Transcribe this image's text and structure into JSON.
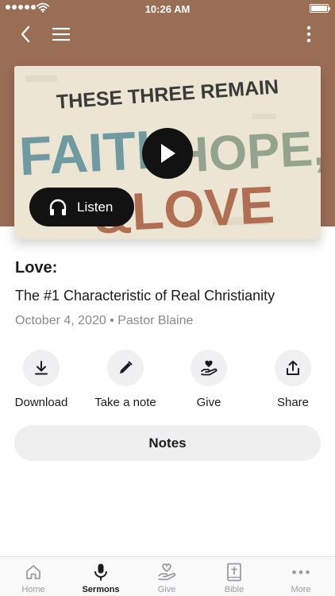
{
  "status_bar": {
    "time": "10:26 AM"
  },
  "hero": {
    "line1": "THESE THREE REMAIN",
    "faith": "FAITH",
    "hope": "HOPE,",
    "amp": "&",
    "love": "LOVE",
    "listen_label": "Listen"
  },
  "sermon": {
    "title": "Love:",
    "subtitle": "The #1 Characteristic of Real Christianity",
    "meta": "October 4, 2020 • Pastor Blaine"
  },
  "actions": [
    {
      "label": "Download",
      "icon": "download-icon"
    },
    {
      "label": "Take a note",
      "icon": "pencil-icon"
    },
    {
      "label": "Give",
      "icon": "hand-heart-icon"
    },
    {
      "label": "Share",
      "icon": "share-icon"
    }
  ],
  "notes_label": "Notes",
  "tabs": [
    {
      "label": "Home",
      "icon": "home-icon",
      "active": false
    },
    {
      "label": "Sermons",
      "icon": "microphone-icon",
      "active": true
    },
    {
      "label": "Give",
      "icon": "hand-heart-icon",
      "active": false
    },
    {
      "label": "Bible",
      "icon": "bible-icon",
      "active": false
    },
    {
      "label": "More",
      "icon": "more-icon",
      "active": false
    }
  ],
  "colors": {
    "header": "#9a6d55",
    "faith": "#6f9aa0",
    "hope": "#93a38e",
    "love": "#b06f52",
    "title_text": "#3a3a38"
  }
}
